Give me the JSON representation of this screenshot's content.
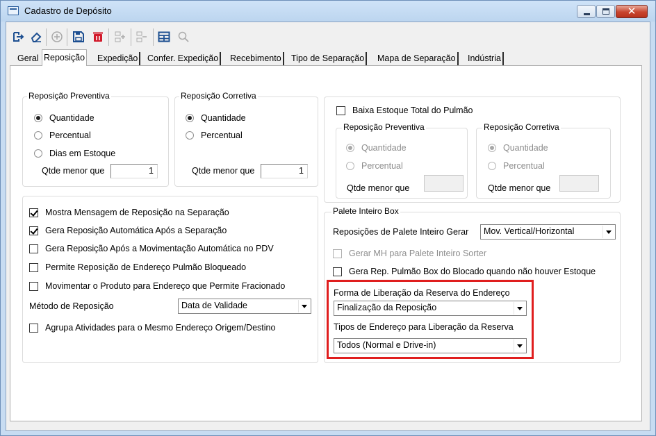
{
  "window": {
    "title": "Cadastro de Depósito",
    "close_glyph": "✕"
  },
  "toolbar": {
    "buttons": [
      {
        "name": "exit-icon"
      },
      {
        "name": "eraser-icon"
      },
      {
        "name": "add-circle-icon"
      },
      {
        "name": "save-icon"
      },
      {
        "name": "delete-icon"
      },
      {
        "name": "add-item-icon"
      },
      {
        "name": "remove-item-icon"
      },
      {
        "name": "grid-icon"
      },
      {
        "name": "search-icon"
      }
    ]
  },
  "tabs": [
    "Geral",
    "Reposição",
    "Expedição",
    "Confer. Expedição",
    "Recebimento",
    "Tipo de Separação",
    "Mapa de Separação",
    "Indústria"
  ],
  "active_tab": "Reposição",
  "rep_preventiva": {
    "title": "Reposição Preventiva",
    "options": [
      "Quantidade",
      "Percentual",
      "Dias em Estoque"
    ],
    "selected": "Quantidade",
    "qtde_label": "Qtde menor que",
    "qtde_value": "1"
  },
  "rep_corretiva": {
    "title": "Reposição Corretiva",
    "options": [
      "Quantidade",
      "Percentual"
    ],
    "selected": "Quantidade",
    "qtde_label": "Qtde menor que",
    "qtde_value": "1"
  },
  "baixa": {
    "label": "Baixa Estoque Total do Pulmão",
    "checked": false,
    "preventiva": {
      "title": "Reposição Preventiva",
      "options": [
        "Quantidade",
        "Percentual"
      ],
      "qtde_label": "Qtde menor que",
      "qtde_value": ""
    },
    "corretiva": {
      "title": "Reposição Corretiva",
      "options": [
        "Quantidade",
        "Percentual"
      ],
      "qtde_label": "Qtde menor que",
      "qtde_value": ""
    }
  },
  "options_panel": {
    "checks": [
      {
        "label": "Mostra Mensagem de Reposição na Separação",
        "checked": true
      },
      {
        "label": "Gera Reposição Automática Após a Separação",
        "checked": true
      },
      {
        "label": "Gera Reposição Após a Movimentação Automática no PDV",
        "checked": false
      },
      {
        "label": "Permite Reposição de Endereço Pulmão Bloqueado",
        "checked": false
      },
      {
        "label": "Movimentar o Produto para Endereço que Permite Fracionado",
        "checked": false
      }
    ],
    "metodo_label": "Método de Reposição",
    "metodo_value": "Data de Validade",
    "agrupa_label": "Agrupa Atividades para o Mesmo Endereço Origem/Destino",
    "agrupa_checked": false
  },
  "palete": {
    "title": "Palete Inteiro Box",
    "reposicoes_label": "Reposições de Palete Inteiro Gerar",
    "reposicoes_value": "Mov. Vertical/Horizontal",
    "gerar_mh_label": "Gerar MH para Palete Inteiro Sorter",
    "gera_rep_label": "Gera Rep. Pulmão Box do Blocado quando não houver Estoque",
    "forma_label": "Forma de Liberação da Reserva do Endereço",
    "forma_value": "Finalização da Reposição",
    "tipos_label": "Tipos de Endereço para Liberação da Reserva",
    "tipos_value": "Todos (Normal e Drive-in)"
  },
  "colors": {
    "highlight": "#e01e1e",
    "title_bar": "#c7dcf2"
  }
}
